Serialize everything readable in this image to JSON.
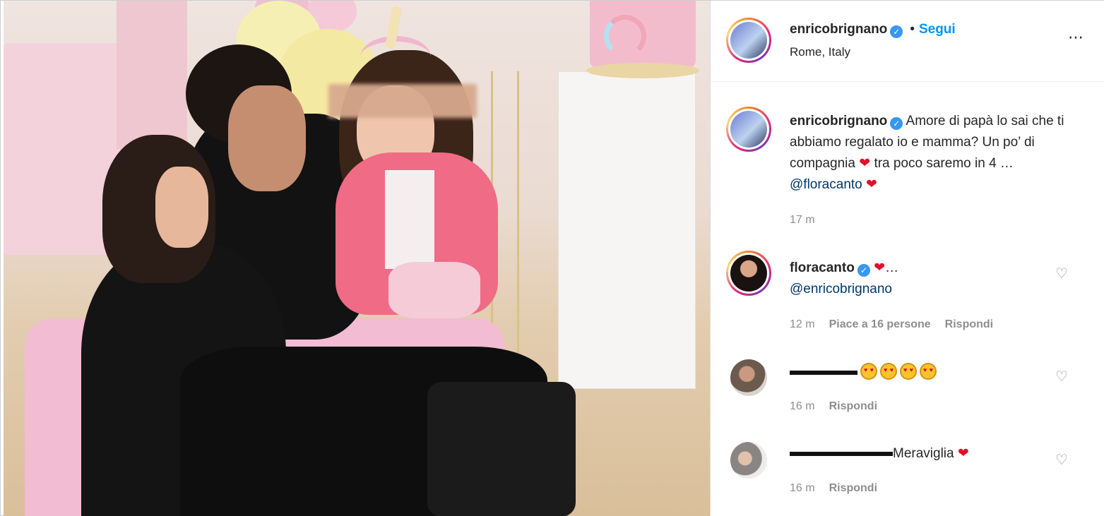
{
  "post": {
    "username": "enricobrignano",
    "follow_label": "Segui",
    "separator": "•",
    "location": "Rome, Italy",
    "more_icon": "⋯",
    "verified_glyph": "✓"
  },
  "caption": {
    "username": "enricobrignano",
    "text_part1": "Amore di papà lo sai che ti abbiamo regalato io e mamma? Un po’ di compagnia",
    "text_part2": "tra poco saremo in 4 …",
    "mention": "@floracanto",
    "time": "17 m"
  },
  "comments": [
    {
      "username": "floracanto",
      "text_suffix": "…",
      "mention": "@enricobrignano",
      "time": "12 m",
      "likes": "Piace a 16 persone",
      "reply": "Rispondi"
    },
    {
      "username": "",
      "text": "",
      "time": "16 m",
      "reply": "Rispondi"
    },
    {
      "username": "",
      "text": "Meraviglia",
      "time": "16 m",
      "reply": "Rispondi"
    }
  ],
  "icons": {
    "heart_filled": "❤",
    "heart_outline": "♡"
  },
  "colors": {
    "accent_blue": "#0095f6",
    "mention_blue": "#00376b",
    "heart_red": "#e0102a",
    "meta_gray": "#8e8e8e"
  }
}
